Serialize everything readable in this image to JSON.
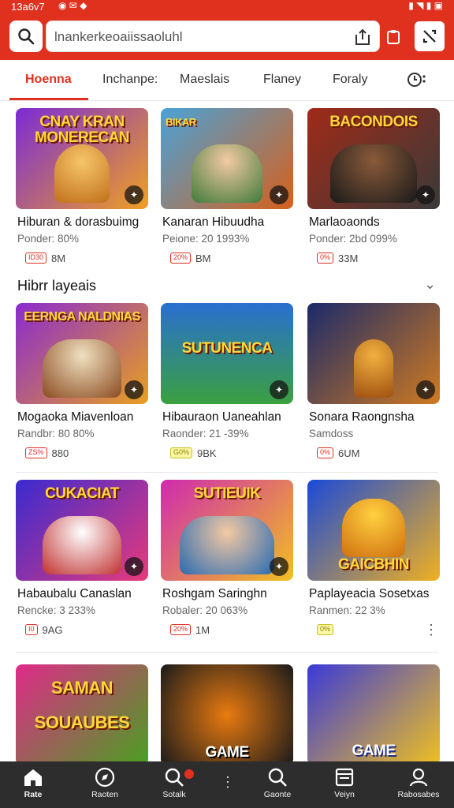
{
  "status_bar": {
    "time": "13a6v7",
    "left_icons": "◉  ✉  ◆",
    "right_icons": "▮ ◥ ▮ ▣"
  },
  "search": {
    "value": "lnankerkeoaiissaoluhl",
    "placeholder": ""
  },
  "tabs": [
    {
      "label": "Hoenna"
    },
    {
      "label": "Inchanpe:"
    },
    {
      "label": "Maeslais"
    },
    {
      "label": "Flaney"
    },
    {
      "label": "Foraly"
    }
  ],
  "section": {
    "title": "Hibrr layeais"
  },
  "cards": [
    {
      "art": "CNAY KRAN MONERECAN",
      "title": "Hiburan & dorasbuimg",
      "sub": "Ponder: 80%",
      "badge": "ID30",
      "meta": "8M",
      "bg1": "#7a2bd6",
      "bg2": "#f0a020"
    },
    {
      "art": "BIKAR",
      "title": "Kanaran Hibuudha",
      "sub": "Peione: 20 1993%",
      "badge": "20%",
      "meta": "BM",
      "bg1": "#49a2d8",
      "bg2": "#d8601a"
    },
    {
      "art": "BACONDOIS",
      "title": "Marlaoaonds",
      "sub": "Ponder: 2bd 099%",
      "badge": "0%",
      "meta": "33M",
      "bg1": "#a02a18",
      "bg2": "#3a3a3a"
    },
    {
      "art": "EERNGA NALDNIAS",
      "title": "Mogaoka Miavenloan",
      "sub": "Randbr: 80 80%",
      "badge": "ZS%",
      "meta": "880",
      "bg1": "#8a2ad0",
      "bg2": "#e8a020"
    },
    {
      "art": "SUTUNENCA",
      "title": "Hibauraon Uaneahlan",
      "sub": "Raonder: 21 -39%",
      "badge": "G0%",
      "meta": "9BK",
      "bg1": "#2a6fd0",
      "bg2": "#3aa040"
    },
    {
      "art": "",
      "title": "Sonara Raongnsha",
      "sub": "Samdoss",
      "badge": "0%",
      "meta": "6UM",
      "bg1": "#1a2a6a",
      "bg2": "#d07a20"
    },
    {
      "art": "CUKACIAT",
      "title": "Habaubalu Canaslan",
      "sub": "Rencke: 3 233%",
      "badge": "I0",
      "meta": "9AG",
      "bg1": "#3a2ad0",
      "bg2": "#e83a7a"
    },
    {
      "art": "SUTIEUIK",
      "title": "Roshgam Saringhn",
      "sub": "Robaler: 20 063%",
      "badge": "20%",
      "meta": "1M",
      "bg1": "#d02ab0",
      "bg2": "#f0c020"
    },
    {
      "art": "GAICBHIN",
      "title": "Paplayeacia Sosetxas",
      "sub": "Ranmen: 22 3%",
      "badge": "0%",
      "meta": "",
      "bg1": "#1a4ad8",
      "bg2": "#f0b020"
    },
    {
      "art": "SAMAN SOUAUBES",
      "title": "",
      "sub": "",
      "badge": "",
      "meta": "",
      "bg1": "#e02a8a",
      "bg2": "#4aa020"
    },
    {
      "art": "GAME",
      "title": "",
      "sub": "",
      "badge": "",
      "meta": "",
      "bg1": "#1a1a1a",
      "bg2": "#e87a10"
    },
    {
      "art": "GAME",
      "title": "",
      "sub": "",
      "badge": "",
      "meta": "",
      "bg1": "#3a3ad8",
      "bg2": "#f0c020"
    }
  ],
  "bottom_nav": [
    {
      "label": "Rate",
      "icon": "home-icon"
    },
    {
      "label": "Raoten",
      "icon": "compass-icon"
    },
    {
      "label": "Sotalk",
      "icon": "search-icon"
    },
    {
      "label": "Gaonte",
      "icon": "search-icon"
    },
    {
      "label": "Veiyn",
      "icon": "book-icon"
    },
    {
      "label": "Rabosabes",
      "icon": "user-icon"
    }
  ],
  "colors": {
    "accent": "#e0301e",
    "nav_bg": "#2d2d2d"
  }
}
